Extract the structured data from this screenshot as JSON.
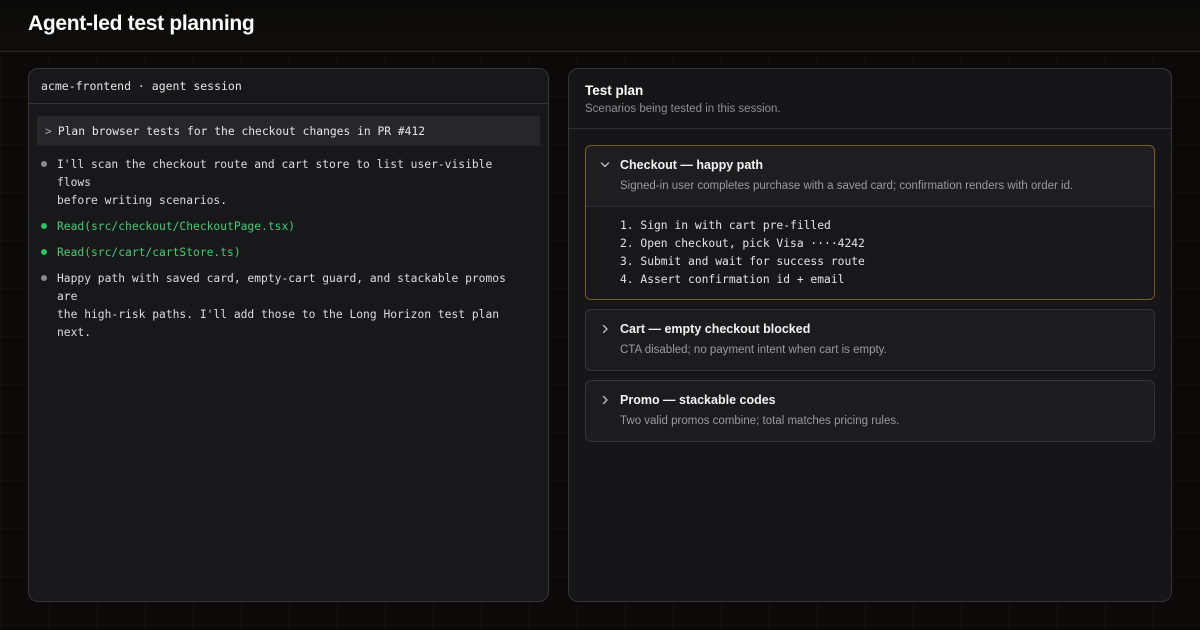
{
  "app": {
    "title": "Agent-led test planning"
  },
  "session": {
    "header": "acme-frontend · agent session",
    "prompt_caret": ">",
    "prompt": "Plan browser tests for the checkout changes in PR #412",
    "log": [
      {
        "kind": "text",
        "text": "I'll scan the checkout route and cart store to list user-visible flows\nbefore writing scenarios."
      },
      {
        "kind": "tool",
        "text": "Read(src/checkout/CheckoutPage.tsx)"
      },
      {
        "kind": "tool",
        "text": "Read(src/cart/cartStore.ts)"
      },
      {
        "kind": "text",
        "text": "Happy path with saved card, empty-cart guard, and stackable promos are\nthe high-risk paths. I'll add those to the Long Horizon test plan next."
      }
    ]
  },
  "plan": {
    "title": "Test plan",
    "subtitle": "Scenarios being tested in this session.",
    "scenarios": [
      {
        "title": "Checkout — happy path",
        "description": "Signed-in user completes purchase with a saved card; confirmation renders with order id.",
        "expanded": true,
        "steps": [
          "1. Sign in with cart pre-filled",
          "2. Open checkout, pick Visa ····4242",
          "3. Submit and wait for success route",
          "4. Assert confirmation id + email"
        ]
      },
      {
        "title": "Cart — empty checkout blocked",
        "description": "CTA disabled; no payment intent when cart is empty.",
        "expanded": false
      },
      {
        "title": "Promo — stackable codes",
        "description": "Two valid promos combine; total matches pricing rules.",
        "expanded": false
      }
    ]
  },
  "colors": {
    "accent_border": "#7a5d1e",
    "tool_green": "#3ecf73",
    "background": "#0b0a09"
  },
  "icons": {
    "expanded": "chevron-down-icon",
    "collapsed": "chevron-right-icon"
  }
}
